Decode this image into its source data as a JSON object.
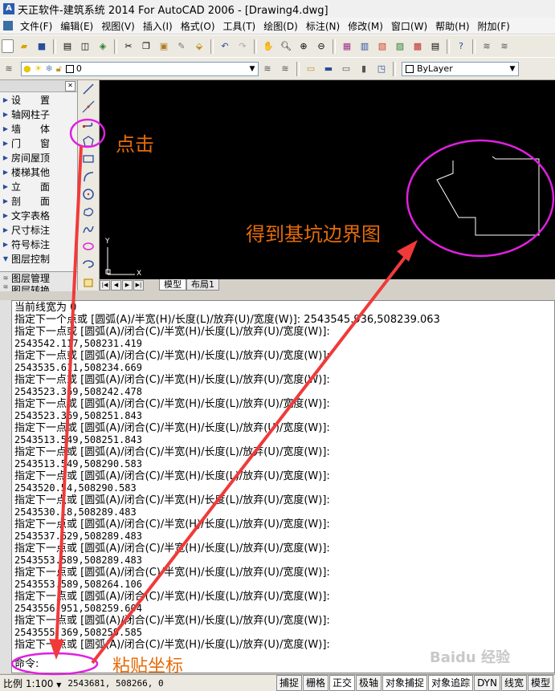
{
  "window": {
    "title": "天正软件-建筑系统 2014  For AutoCAD 2006 - [Drawing4.dwg]"
  },
  "menu": {
    "items": [
      "文件(F)",
      "编辑(E)",
      "视图(V)",
      "插入(I)",
      "格式(O)",
      "工具(T)",
      "绘图(D)",
      "标注(N)",
      "修改(M)",
      "窗口(W)",
      "帮助(H)",
      "附加(F)"
    ]
  },
  "layer_toolbar": {
    "layer_value": "0",
    "linetype_value": "ByLayer"
  },
  "tool_panel": {
    "items": [
      "设　　置",
      "轴网柱子",
      "墙　　体",
      "门　　窗",
      "房间屋顶",
      "楼梯其他",
      "立　　面",
      "剖　　面",
      "文字表格",
      "尺寸标注",
      "符号标注",
      "图层控制"
    ],
    "bottom_items": [
      "图层管理",
      "图层转换"
    ]
  },
  "canvas": {
    "ucs_y": "Y",
    "ucs_x": "X",
    "tabs": [
      "模型",
      "布局1"
    ]
  },
  "command_window": {
    "lines": [
      "当前线宽为 0",
      "指定下一个点或 [圆弧(A)/半宽(H)/长度(L)/放弃(U)/宽度(W)]: 2543545.936,508239.063",
      "指定下一点或 [圆弧(A)/闭合(C)/半宽(H)/长度(L)/放弃(U)/宽度(W)]:",
      "2543542.117,508231.419",
      "指定下一点或 [圆弧(A)/闭合(C)/半宽(H)/长度(L)/放弃(U)/宽度(W)]:",
      "2543535.611,508234.669",
      "指定下一点或 [圆弧(A)/闭合(C)/半宽(H)/长度(L)/放弃(U)/宽度(W)]:",
      "2543523.369,508242.478",
      "指定下一点或 [圆弧(A)/闭合(C)/半宽(H)/长度(L)/放弃(U)/宽度(W)]:",
      "2543523.369,508251.843",
      "指定下一点或 [圆弧(A)/闭合(C)/半宽(H)/长度(L)/放弃(U)/宽度(W)]:",
      "2543513.549,508251.843",
      "指定下一点或 [圆弧(A)/闭合(C)/半宽(H)/长度(L)/放弃(U)/宽度(W)]:",
      "2543513.549,508290.583",
      "指定下一点或 [圆弧(A)/闭合(C)/半宽(H)/长度(L)/放弃(U)/宽度(W)]:",
      "2543520.54,508290.583",
      "指定下一点或 [圆弧(A)/闭合(C)/半宽(H)/长度(L)/放弃(U)/宽度(W)]:",
      "2543530.18,508289.483",
      "指定下一点或 [圆弧(A)/闭合(C)/半宽(H)/长度(L)/放弃(U)/宽度(W)]:",
      "2543537.629,508289.483",
      "指定下一点或 [圆弧(A)/闭合(C)/半宽(H)/长度(L)/放弃(U)/宽度(W)]:",
      "2543553.589,508289.483",
      "指定下一点或 [圆弧(A)/闭合(C)/半宽(H)/长度(L)/放弃(U)/宽度(W)]:",
      "2543553.589,508264.106",
      "指定下一点或 [圆弧(A)/闭合(C)/半宽(H)/长度(L)/放弃(U)/宽度(W)]:",
      "2543556.951,508259.604",
      "指定下一点或 [圆弧(A)/闭合(C)/半宽(H)/长度(L)/放弃(U)/宽度(W)]:",
      "2543555.369,508259.585",
      "指定下一点或 [圆弧(A)/闭合(C)/半宽(H)/长度(L)/放弃(U)/宽度(W)]:"
    ],
    "prompt": "命令:"
  },
  "status_bar": {
    "scale": "比例 1:100",
    "coords": "2543681, 508266, 0",
    "buttons": [
      "捕捉",
      "栅格",
      "正交",
      "极轴",
      "对象捕捉",
      "对象追踪",
      "DYN",
      "线宽",
      "模型"
    ]
  },
  "annotations": {
    "click": "点击",
    "result": "得到基坑边界图",
    "paste": "粘贴坐标",
    "color": "#e46c0a",
    "ellipse_color": "#e020e0",
    "arrow_color": "#f03a3a"
  },
  "watermark": "Baidu 经验"
}
